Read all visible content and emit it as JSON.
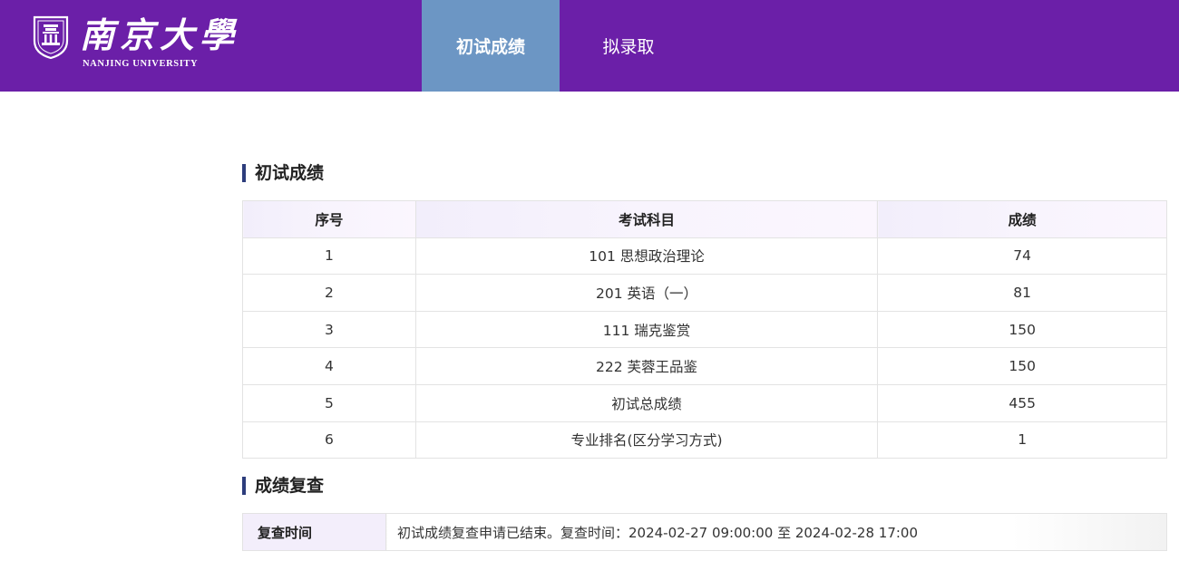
{
  "header": {
    "brand_cn": "南京大學",
    "brand_en": "NANJING UNIVERSITY",
    "tabs": [
      {
        "label": "初试成绩",
        "active": true
      },
      {
        "label": "拟录取",
        "active": false
      }
    ],
    "colors": {
      "header_bg": "#6b1fa8",
      "active_tab": "#6c96c4"
    }
  },
  "scores": {
    "title": "初试成绩",
    "columns": [
      "序号",
      "考试科目",
      "成绩"
    ],
    "rows": [
      [
        "1",
        "101 思想政治理论",
        "74"
      ],
      [
        "2",
        "201 英语（一）",
        "81"
      ],
      [
        "3",
        "111 瑞克鉴赏",
        "150"
      ],
      [
        "4",
        "222 芙蓉王品鉴",
        "150"
      ],
      [
        "5",
        "初试总成绩",
        "455"
      ],
      [
        "6",
        "专业排名(区分学习方式)",
        "1"
      ]
    ]
  },
  "review": {
    "title": "成绩复查",
    "label": "复查时间",
    "value": "初试成绩复查申请已结束。复查时间：2024-02-27 09:00:00 至 2024-02-28 17:00"
  }
}
